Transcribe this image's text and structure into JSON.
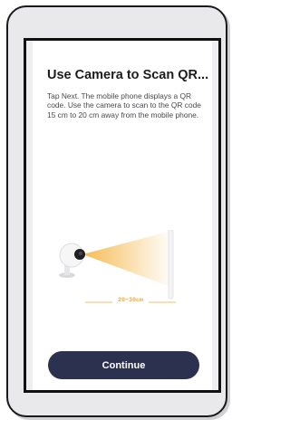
{
  "screen": {
    "title": "Use Camera to Scan QR...",
    "description": "Tap Next. The mobile phone displays a QR code. Use the camera to scan to the QR code 15 cm to 20 cm away from the mobile phone."
  },
  "illustration": {
    "distance_label": "20~30cm",
    "beam_color": "#f5b84a",
    "dimension_color": "#f0a93a"
  },
  "actions": {
    "continue_label": "Continue"
  },
  "colors": {
    "button": "#2d3150",
    "background": "#ffffff",
    "frame": "#1a1a1a"
  }
}
